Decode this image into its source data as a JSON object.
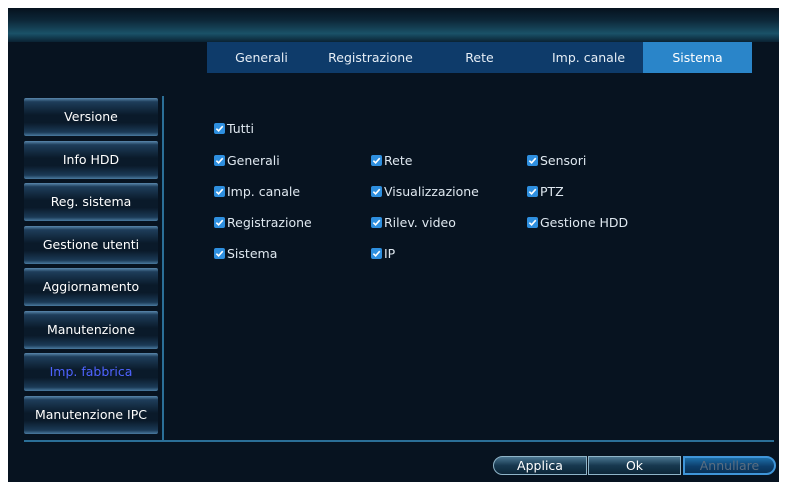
{
  "tabs": [
    {
      "label": "Generali"
    },
    {
      "label": "Registrazione"
    },
    {
      "label": "Rete"
    },
    {
      "label": "Imp. canale"
    },
    {
      "label": "Sistema",
      "active": true
    }
  ],
  "sidebar": {
    "items": [
      {
        "label": "Versione"
      },
      {
        "label": "Info HDD"
      },
      {
        "label": "Reg. sistema"
      },
      {
        "label": "Gestione utenti"
      },
      {
        "label": "Aggiornamento"
      },
      {
        "label": "Manutenzione"
      },
      {
        "label": "Imp. fabbrica",
        "active": true
      },
      {
        "label": "Manutenzione IPC"
      }
    ]
  },
  "checkboxes": {
    "all": {
      "label": "Tutti",
      "checked": true
    },
    "col1": [
      {
        "label": "Generali",
        "checked": true
      },
      {
        "label": "Imp. canale",
        "checked": true
      },
      {
        "label": "Registrazione",
        "checked": true
      },
      {
        "label": "Sistema",
        "checked": true
      }
    ],
    "col2": [
      {
        "label": "Rete",
        "checked": true
      },
      {
        "label": "Visualizzazione",
        "checked": true
      },
      {
        "label": "Rilev. video",
        "checked": true
      },
      {
        "label": "IP",
        "checked": true
      }
    ],
    "col3": [
      {
        "label": "Sensori",
        "checked": true
      },
      {
        "label": "PTZ",
        "checked": true
      },
      {
        "label": "Gestione HDD",
        "checked": true
      }
    ]
  },
  "buttons": {
    "apply": "Applica",
    "ok": "Ok",
    "cancel": "Annullare"
  },
  "colors": {
    "accent": "#2a85c9",
    "checkbox": "#2e8fdf",
    "active_sidebar_text": "#4f63ff"
  }
}
